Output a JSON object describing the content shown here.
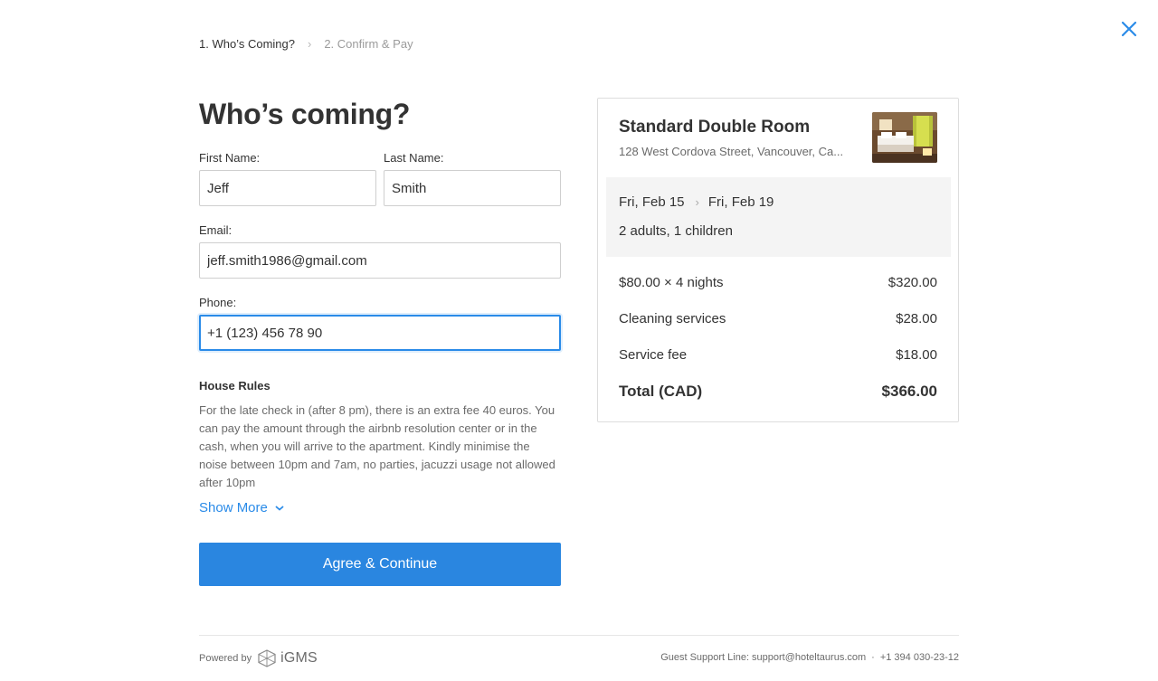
{
  "stepper": {
    "step1": "1. Who’s Coming?",
    "step2": "2. Confirm & Pay"
  },
  "form": {
    "heading": "Who’s coming?",
    "first_name_label": "First Name:",
    "first_name_value": "Jeff",
    "last_name_label": "Last Name:",
    "last_name_value": "Smith",
    "email_label": "Email:",
    "email_value": "jeff.smith1986@gmail.com",
    "phone_label": "Phone:",
    "phone_value": "+1 (123) 456 78 90"
  },
  "house_rules": {
    "title": "House Rules",
    "text": "For the late check in (after 8 pm), there is an extra fee 40 euros. You can pay the amount through the airbnb resolution center or in the cash, when you will arrive to the apartment. Kindly minimise the noise between 10pm and 7am, no parties, jacuzzi usage not allowed after 10pm",
    "show_more": "Show More"
  },
  "agree_button": "Agree & Continue",
  "summary": {
    "room_title": "Standard Double Room",
    "address": "128 West Cordova Street, Vancouver, Ca...",
    "check_in": "Fri, Feb 15",
    "check_out": "Fri, Feb 19",
    "guests": "2 adults, 1 children",
    "lines": [
      {
        "label": "$80.00 × 4 nights",
        "amount": "$320.00"
      },
      {
        "label": "Cleaning services",
        "amount": "$28.00"
      },
      {
        "label": "Service fee",
        "amount": "$18.00"
      }
    ],
    "total_label": "Total (CAD)",
    "total_amount": "$366.00"
  },
  "footer": {
    "powered_by": "Powered by",
    "brand": "iGMS",
    "support_prefix": "Guest Support Line:",
    "support_email": "support@hoteltaurus.com",
    "separator": "·",
    "support_phone": "+1 394 030-23-12"
  },
  "colors": {
    "accent": "#2a86e0",
    "link": "#2a8be8",
    "text": "#333333",
    "muted": "#6b6b6b"
  }
}
